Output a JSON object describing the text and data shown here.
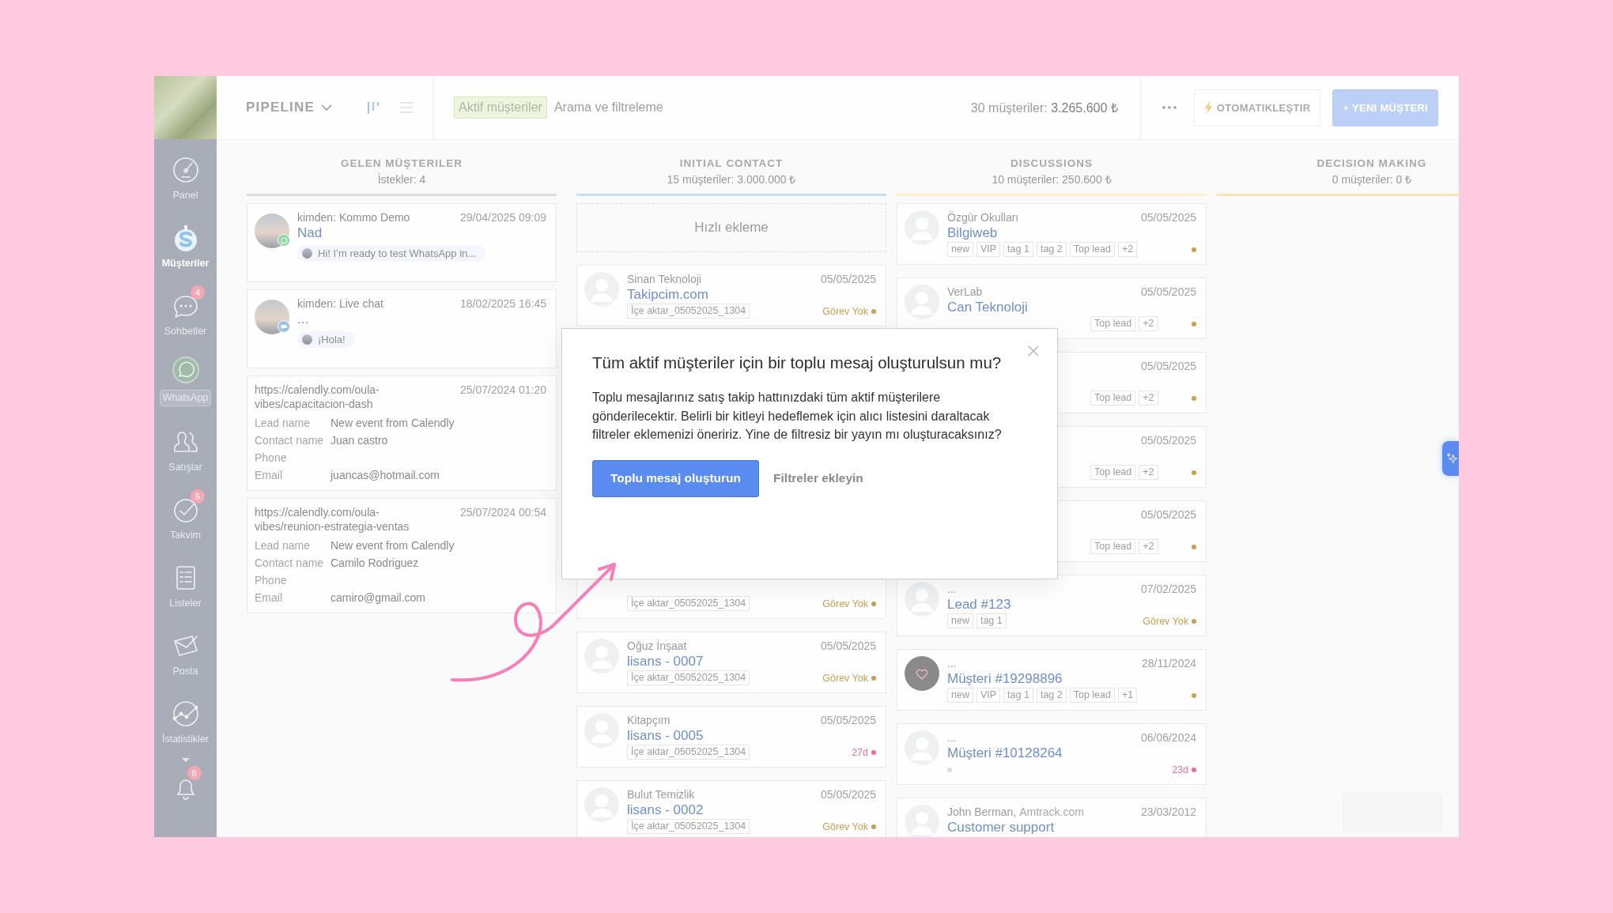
{
  "sidebar": {
    "items": [
      {
        "label": "Panel",
        "kind": "nav",
        "selected": false
      },
      {
        "label": "Müşteriler",
        "kind": "nav",
        "selected": true
      },
      {
        "label": "Sohbetler",
        "kind": "nav",
        "selected": false,
        "badge": "4"
      },
      {
        "label": "WhatsApp",
        "kind": "app",
        "selected": false
      },
      {
        "label": "Satışlar",
        "kind": "nav",
        "selected": false
      },
      {
        "label": "Takvim",
        "kind": "nav",
        "selected": false,
        "badge": "5"
      },
      {
        "label": "Listeler",
        "kind": "nav",
        "selected": false
      },
      {
        "label": "Posta",
        "kind": "nav",
        "selected": false
      },
      {
        "label": "İstatistikler",
        "kind": "nav",
        "selected": false
      }
    ],
    "bell_badge": "8"
  },
  "toolbar": {
    "title": "PIPELINE",
    "view_modes": [
      {
        "selected": true
      },
      {
        "selected": false
      }
    ],
    "search": {
      "filter_tag": "Aktif müşteriler",
      "placeholder": "Arama ve filtreleme"
    },
    "summary_label": "30 müşteriler:",
    "summary_value": "3.265.600 ₺",
    "automate_button": "OTOMATIKLEŞTIR",
    "new_button": "+ YENI MÜŞTERI"
  },
  "columns": [
    {
      "title": "GELEN MÜŞTERILER",
      "subtitle": "İstekler: 4",
      "color": "#dcdcdc",
      "cards": [
        {
          "kind": "chat",
          "from": "kimden: Kommo Demo",
          "date": "29/04/2025 09:09",
          "name": "Nad",
          "via_whatsapp": true,
          "message": "Hi! I’m ready to test WhatsApp in..."
        },
        {
          "kind": "chat",
          "from": "kimden: Live chat",
          "date": "18/02/2025 16:45",
          "name": "...",
          "via_whatsapp": false,
          "message": "¡Hola!"
        },
        {
          "kind": "form",
          "url": "https://calendly.com/oula-vibes/capacitacion-dash",
          "date": "25/07/2024 01:20",
          "fields": [
            {
              "label": "Lead name",
              "value": "New event from Calendly"
            },
            {
              "label": "Contact name",
              "value": "Juan castro"
            },
            {
              "label": "Phone"
            },
            {
              "label": "Email",
              "value": "juancas@hotmail.com"
            }
          ]
        },
        {
          "kind": "form",
          "url": "https://calendly.com/oula-vibes/reunion-estrategia-ventas",
          "date": "25/07/2024 00:54",
          "fields": [
            {
              "label": "Lead name",
              "value": "New event from Calendly"
            },
            {
              "label": "Contact name",
              "value": "Camilo Rodriguez"
            },
            {
              "label": "Phone"
            },
            {
              "label": "Email",
              "value": "camiro@gmail.com"
            }
          ]
        }
      ]
    },
    {
      "title": "INITIAL CONTACT",
      "subtitle": "15 müşteriler: 3.000.000 ₺",
      "color": "#c9def6",
      "quick_add": "Hızlı ekleme",
      "cards": [
        {
          "kind": "lead",
          "company": "Sinan Teknoloji",
          "date": "05/05/2025",
          "name": "Takipcim.com",
          "tags": [
            "İçe aktar_05052025_1304"
          ],
          "task": {
            "kind": "none",
            "text": "Görev Yok"
          }
        },
        {
          "kind": "lead_bottom",
          "tags": [
            "İçe aktar_05052025_1304"
          ],
          "task": {
            "kind": "none",
            "text": "Görev Yok"
          }
        },
        {
          "kind": "lead",
          "company": "Oğuz İnşaat",
          "date": "05/05/2025",
          "name": "lisans - 0007",
          "tags": [
            "İçe aktar_05052025_1304"
          ],
          "task": {
            "kind": "none",
            "text": "Görev Yok"
          }
        },
        {
          "kind": "lead",
          "company": "Kitapçım",
          "date": "05/05/2025",
          "name": "lisans - 0005",
          "tags": [
            "İçe aktar_05052025_1304"
          ],
          "task": {
            "kind": "overdue",
            "text": "27d"
          }
        },
        {
          "kind": "lead",
          "company": "Bulut Temizlik",
          "date": "05/05/2025",
          "name": "lisans - 0002",
          "tags": [
            "İçe aktar_05052025_1304"
          ],
          "task": {
            "kind": "none",
            "text": "Görev Yok"
          }
        }
      ]
    },
    {
      "title": "DISCUSSIONS",
      "subtitle": "10 müşteriler: 250.600 ₺",
      "color": "#fbf1c4",
      "cards": [
        {
          "kind": "lead",
          "company": "Özgür Okulları",
          "date": "05/05/2025",
          "name": "Bilgiweb",
          "tags": [
            "new",
            "VIP",
            "tag 1",
            "tag 2",
            "Top lead",
            "+2"
          ],
          "task": {
            "kind": "none"
          }
        },
        {
          "kind": "lead_shifted",
          "company": "VerLab",
          "date": "05/05/2025",
          "name": "Can Teknoloji",
          "tags": [
            "Top lead",
            "+2"
          ],
          "task": {
            "kind": "none"
          }
        },
        {
          "kind": "lead_tail",
          "date": "05/05/2025",
          "tags": [
            "Top lead",
            "+2"
          ],
          "task": {
            "kind": "none"
          }
        },
        {
          "kind": "lead_tail",
          "date": "05/05/2025",
          "tags": [
            "Top lead",
            "+2"
          ],
          "task": {
            "kind": "none"
          }
        },
        {
          "kind": "lead_tail",
          "date": "05/05/2025",
          "tags": [
            "Top lead",
            "+2"
          ],
          "task": {
            "kind": "none"
          }
        },
        {
          "kind": "lead",
          "company": "...",
          "date": "07/02/2025",
          "name": "Lead #123",
          "tags": [
            "new",
            "tag 1"
          ],
          "task": {
            "kind": "none",
            "text": "Görev Yok"
          }
        },
        {
          "kind": "lead",
          "custom_avatar": true,
          "company": "...",
          "date": "28/11/2024",
          "name": "Müşteri #19298896",
          "tags": [
            "new",
            "VIP",
            "tag 1",
            "tag 2",
            "Top lead",
            "+1"
          ],
          "task": {
            "kind": "none"
          }
        },
        {
          "kind": "lead",
          "company": "...",
          "date": "06/06/2024",
          "name": "Müşteri #10128264",
          "tag_dot": true,
          "task": {
            "kind": "overdue",
            "text": "23d"
          }
        },
        {
          "kind": "lead",
          "company": "John Berman,",
          "company_extra": "Amtrack.com",
          "date": "23/03/2012",
          "name": "Customer support"
        }
      ]
    },
    {
      "title": "DECISION MAKING",
      "subtitle": "0 müşteriler: 0 ₺",
      "color": "#fce3b6"
    }
  ],
  "dialog": {
    "title": "Tüm aktif müşteriler için bir toplu mesaj oluşturulsun mu?",
    "body": "Toplu mesajlarınız satış takip hattınızdaki tüm aktif müşterilere gönderilecektir. Belirli bir kitleyi hedeflemek için alıcı listesini daraltacak filtreler eklemenizi öneririz. Yine de filtresiz bir yayın mı oluşturacaksınız?",
    "primary_button": "Toplu mesaj oluşturun",
    "secondary_button": "Filtreler ekleyin"
  }
}
